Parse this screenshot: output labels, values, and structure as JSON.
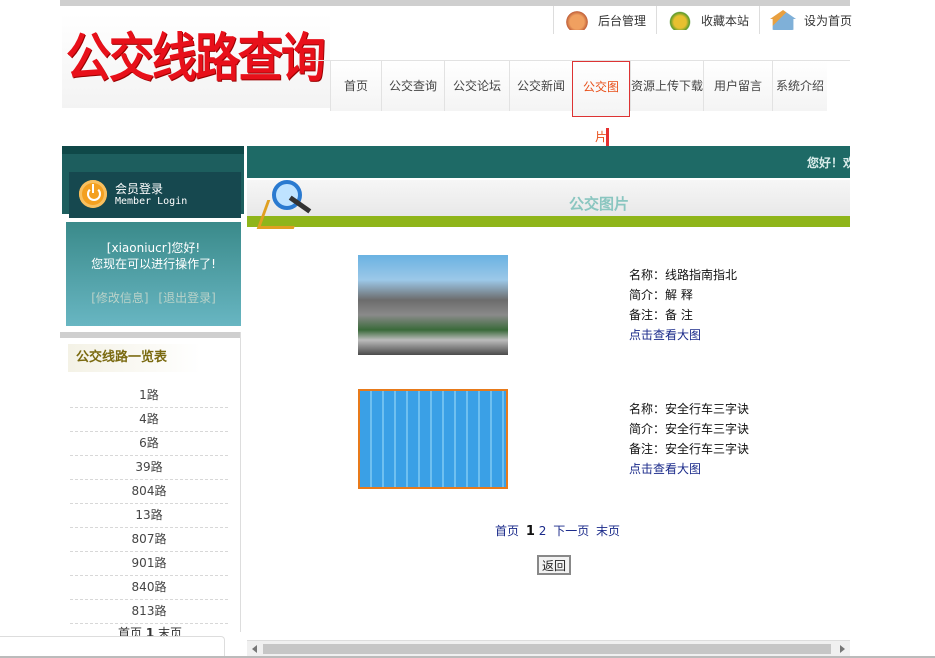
{
  "logo": {
    "text": "公交线路查询"
  },
  "quick_links": [
    {
      "label": "后台管理",
      "icon": "admin-phone-icon"
    },
    {
      "label": "收藏本站",
      "icon": "favorite-icon"
    },
    {
      "label": "设为首页",
      "icon": "home-icon"
    }
  ],
  "nav": [
    "首页",
    "公交查询",
    "公交论坛",
    "公交新闻",
    "公交图片",
    "资源上传下载",
    "用户留言",
    "系统介绍"
  ],
  "nav_active": "公交图片",
  "login": {
    "title": "会员登录",
    "subtitle": "Member Login",
    "greeting_line1": "[xiaoniucr]您好!",
    "greeting_line2": "您现在可以进行操作了!",
    "edit_link": "[修改信息]",
    "logout_link": "[退出登录]"
  },
  "routes": {
    "title": "公交线路一览表",
    "items": [
      "1路",
      "4路",
      "6路",
      "39路",
      "804路",
      "13路",
      "807路",
      "901路",
      "840路",
      "813路"
    ],
    "pager": {
      "first": "首页",
      "current": "1",
      "last": "末页"
    }
  },
  "banner": {
    "marquee": "您好！欢"
  },
  "section": {
    "title": "公交图片"
  },
  "pictures": [
    {
      "name": "名称：线路指南指北",
      "intro": "简介：解 释",
      "note": "备注：备 注",
      "link": "点击查看大图"
    },
    {
      "name": "名称：安全行车三字诀",
      "intro": "简介：安全行车三字诀",
      "note": "备注：安全行车三字诀",
      "link": "点击查看大图"
    }
  ],
  "pager": {
    "first": "首页",
    "current": "1",
    "page2": "2",
    "next": "下一页",
    "last": "末页"
  },
  "back_button": "返回",
  "colors": {
    "accent_red": "#e53030",
    "teal": "#1e6a66",
    "green_bar": "#8fb51a",
    "link": "#1a2a8a"
  }
}
